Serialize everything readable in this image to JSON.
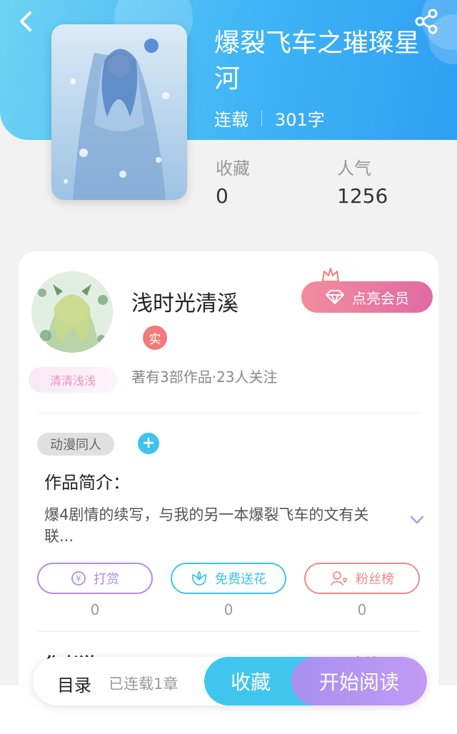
{
  "book": {
    "title": "爆裂飞车之璀璨星河",
    "status": "连载",
    "word_count": "301字",
    "stats": {
      "favorites_label": "收藏",
      "favorites_value": "0",
      "popularity_label": "人气",
      "popularity_value": "1256"
    }
  },
  "author": {
    "name": "浅时光清溪",
    "verified_badge": "实",
    "fan_badge": "清清浅浅",
    "info": "著有3部作品·23人关注",
    "vip_button": "点亮会员"
  },
  "tags": [
    "动漫同人"
  ],
  "add_tag_symbol": "+",
  "intro": {
    "heading": "作品简介：",
    "text": "爆4剧情的续写，与我的另一本爆裂飞车的文有关联..."
  },
  "actions": [
    {
      "label": "打赏",
      "count": "0",
      "icon": "yen-icon",
      "color": "#b48be0"
    },
    {
      "label": "免费送花",
      "count": "0",
      "icon": "flower-icon",
      "color": "#3fc2ee"
    },
    {
      "label": "粉丝榜",
      "count": "0",
      "icon": "fan-rank-icon",
      "color": "#ef8a8a"
    }
  ],
  "section_peek": {
    "title": "作者说",
    "more": "全部(0)"
  },
  "bottom_bar": {
    "toc_label": "目录",
    "toc_status": "已连载1章",
    "collect_button": "收藏",
    "read_button": "开始阅读"
  },
  "colors": {
    "header_blue": "#3fb4f6",
    "collect_blue": "#40c6ee",
    "read_purple": "#b196f2",
    "vip_pink": "#e06aa4"
  }
}
